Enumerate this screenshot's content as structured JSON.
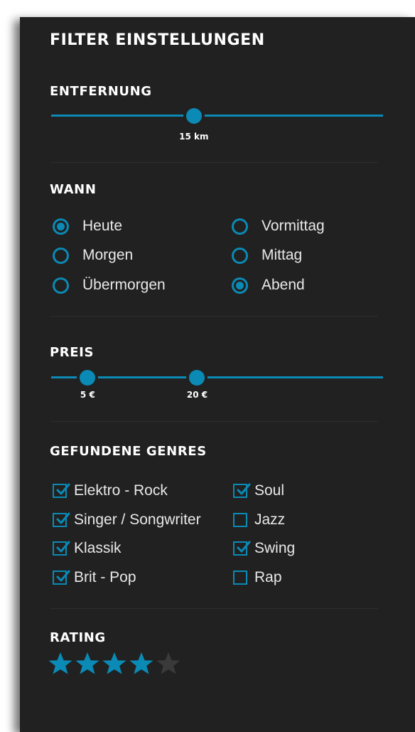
{
  "title": "FILTER EINSTELLUNGEN",
  "distance": {
    "heading": "ENTFERNUNG",
    "value_label": "15 km",
    "value_fraction": 0.43
  },
  "when": {
    "heading": "WANN",
    "options": [
      {
        "label": "Heute",
        "checked": true
      },
      {
        "label": "Morgen",
        "checked": false
      },
      {
        "label": "Übermorgen",
        "checked": false
      },
      {
        "label": "Vormittag",
        "checked": false
      },
      {
        "label": "Mittag",
        "checked": false
      },
      {
        "label": "Abend",
        "checked": true
      }
    ]
  },
  "price": {
    "heading": "PREIS",
    "min_label": "5 €",
    "max_label": "20 €",
    "min_fraction": 0.11,
    "max_fraction": 0.44
  },
  "genres": {
    "heading": "GEFUNDENE GENRES",
    "items": [
      {
        "label": "Elektro - Rock",
        "checked": true
      },
      {
        "label": "Singer / Songwriter",
        "checked": true
      },
      {
        "label": "Klassik",
        "checked": true
      },
      {
        "label": "Brit - Pop",
        "checked": true
      },
      {
        "label": "Soul",
        "checked": true
      },
      {
        "label": "Jazz",
        "checked": false
      },
      {
        "label": "Swing",
        "checked": true
      },
      {
        "label": "Rap",
        "checked": false
      }
    ]
  },
  "rating": {
    "heading": "RATING",
    "value": 4,
    "max": 5
  },
  "colors": {
    "accent": "#0a8ab5",
    "panel_bg": "#212121",
    "star_inactive": "#3a3a3a"
  }
}
